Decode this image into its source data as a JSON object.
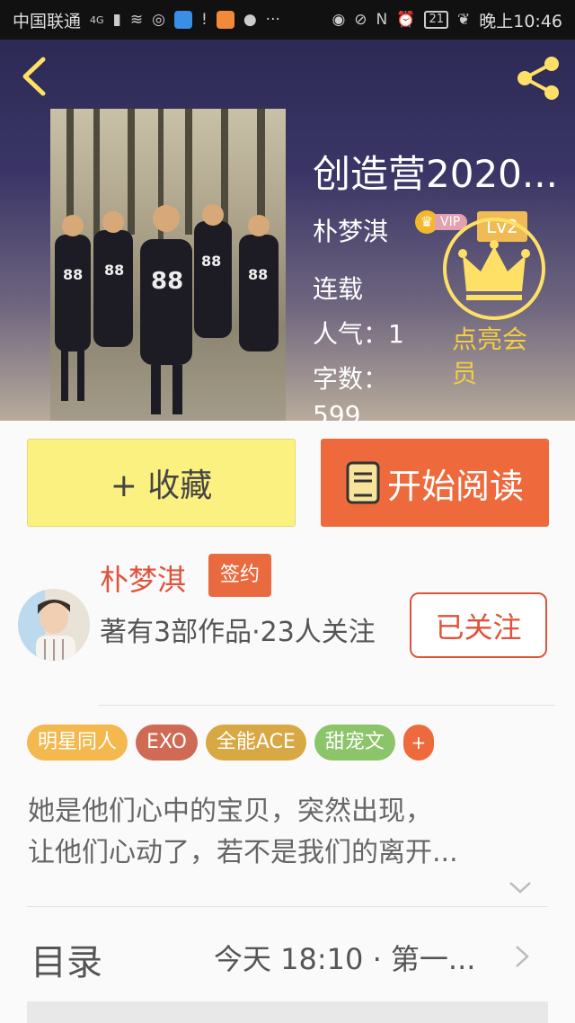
{
  "status_bar": {
    "carrier": "中国联通",
    "network": "4G",
    "battery": "21",
    "time": "晚上10:46"
  },
  "header": {
    "back_icon": "chevron-left-icon",
    "share_icon": "share-icon"
  },
  "book": {
    "title": "创造营2020...",
    "author": "朴梦淇",
    "vip_label": "VIP",
    "level": "Lv2",
    "status": "连载",
    "popularity_label": "人气：",
    "popularity": "1",
    "words_label": "字数：",
    "words": "599",
    "member_text": "点亮会员"
  },
  "actions": {
    "collect_label": "+ 收藏",
    "read_label": "开始阅读"
  },
  "author_section": {
    "name": "朴梦淇",
    "sign_badge": "签约",
    "info": "著有3部作品·23人关注",
    "follow_label": "已关注"
  },
  "tags": [
    {
      "label": "明星同人",
      "color": "#f3b84e"
    },
    {
      "label": "EXO",
      "color": "#cf6a55"
    },
    {
      "label": "全能ACE",
      "color": "#d8a845"
    },
    {
      "label": "甜宠文",
      "color": "#8cc46a"
    },
    {
      "label": "+",
      "color": "#ee6a3c"
    }
  ],
  "description": {
    "line1": "她是他们心中的宝贝，突然出现，",
    "line2": "让他们心动了，若不是我们的离开..."
  },
  "toc": {
    "label": "目录",
    "latest": "今天 18:10 · 第一..."
  },
  "colors": {
    "accent": "#ee6a3c",
    "collect_bg": "#fbf180",
    "author_red": "#e0533a",
    "member_gold": "#f2cd45"
  }
}
